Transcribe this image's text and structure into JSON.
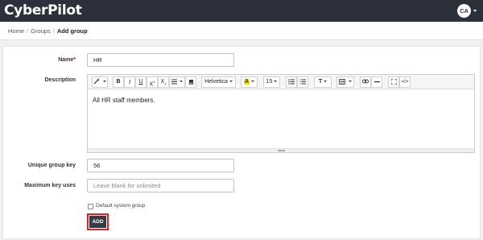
{
  "app": {
    "logo": "CyberPilot",
    "avatar_initials": "CA"
  },
  "breadcrumb": {
    "home": "Home",
    "groups": "Groups",
    "current": "Add group"
  },
  "form": {
    "name": {
      "label": "Name",
      "required_mark": "*",
      "value": "HR"
    },
    "description": {
      "label": "Description",
      "value": "All HR staff members."
    },
    "unique_key": {
      "label": "Unique group key",
      "value": "56"
    },
    "max_uses": {
      "label": "Maximum key uses",
      "value": "",
      "placeholder": "Leave blank for unlimited"
    },
    "default_group": {
      "label": "Default system group",
      "checked": false
    },
    "submit_label": "ADD"
  },
  "toolbar": {
    "magic": "magic-wand-icon",
    "bold": "B",
    "italic": "I",
    "underline": "U",
    "superscript_base": "X",
    "superscript_mark": "2",
    "subscript_base": "X",
    "subscript_mark": "2",
    "align": "align-icon",
    "eraser": "eraser-icon",
    "font_family": "Helvetica",
    "text_color": "A",
    "text_color_hex": "#f5e612",
    "font_size": "15",
    "ul": "unordered-list-icon",
    "ol": "ordered-list-icon",
    "line_height": "T",
    "table": "table-icon",
    "link": "link-icon",
    "hr": "horizontal-rule-icon",
    "fullscreen": "fullscreen-icon",
    "code": "</>"
  },
  "colors": {
    "topbar": "#2b303a",
    "primary_button": "#353c47",
    "highlight": "#d8232a"
  }
}
